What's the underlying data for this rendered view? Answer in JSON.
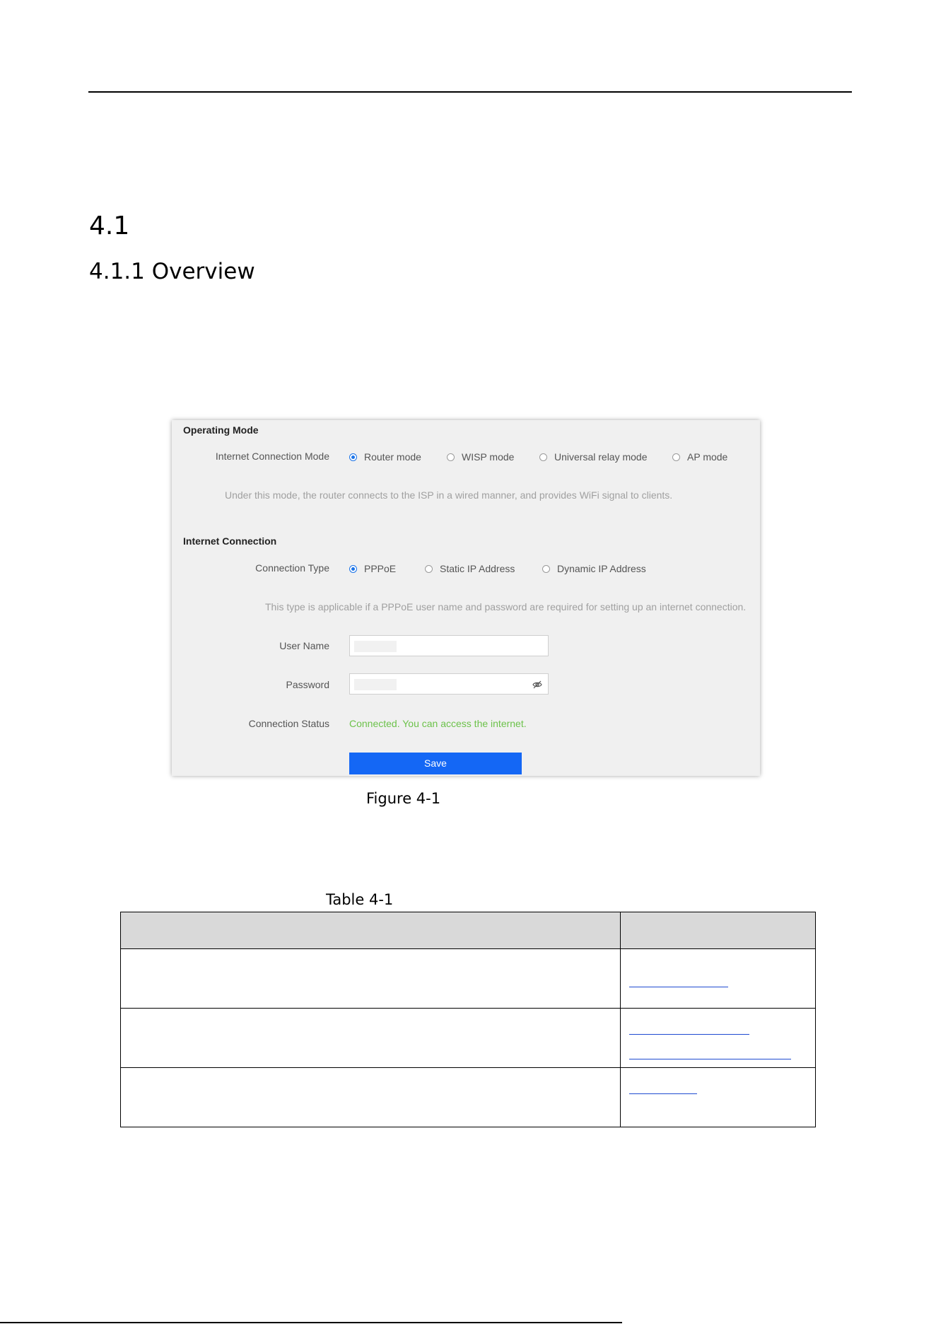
{
  "document": {
    "section_number": "4.1",
    "subsection_title": "4.1.1 Overview"
  },
  "figure": {
    "caption": "Figure 4-1",
    "operating_mode": {
      "title": "Operating Mode",
      "mode_label": "Internet Connection Mode",
      "options": [
        "Router mode",
        "WISP mode",
        "Universal relay mode",
        "AP mode"
      ],
      "selected": "Router mode",
      "hint": "Under this mode, the router connects to the ISP in a wired manner, and provides WiFi signal to clients."
    },
    "internet_connection": {
      "title": "Internet Connection",
      "type_label": "Connection Type",
      "options": [
        "PPPoE",
        "Static IP Address",
        "Dynamic IP Address"
      ],
      "selected": "PPPoE",
      "hint": "This type is applicable if a PPPoE user name and password are required for setting up an internet connection.",
      "username_label": "User Name",
      "password_label": "Password",
      "status_label": "Connection Status",
      "status_text": "Connected. You can access the internet.",
      "save_label": "Save"
    },
    "colors": {
      "accent": "#1a73e8",
      "save_button": "#1467f5",
      "status_ok": "#6cc24a",
      "panel_bg": "#f0f0f0"
    },
    "icons": [
      "radio-selected-icon",
      "radio-unselected-icon",
      "eye-slash-icon"
    ]
  },
  "table": {
    "caption": "Table 4-1",
    "rows": 3
  }
}
